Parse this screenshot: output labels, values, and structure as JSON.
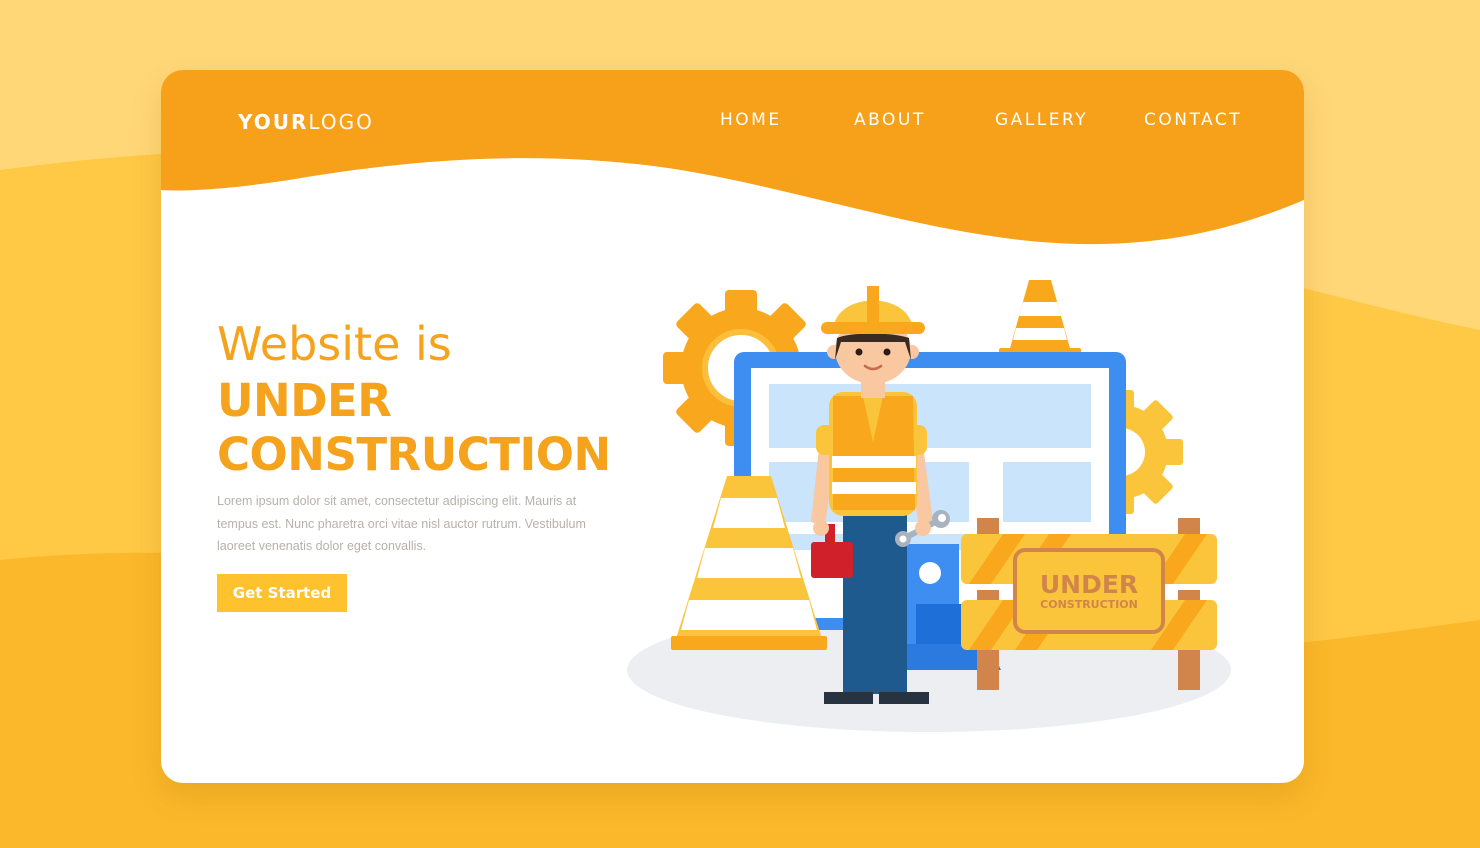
{
  "colors": {
    "bg_light": "#ffd777",
    "bg_mid": "#ffc845",
    "bg_dark": "#fbb82a",
    "header_orange": "#f7a01a",
    "accent": "#f5a21d",
    "button": "#fdc22d",
    "monitor_blue": "#3d8ef0",
    "screen_light": "#c9e4fb"
  },
  "logo": {
    "bold": "YOUR",
    "light": "LOGO"
  },
  "nav": {
    "items": [
      "HOME",
      "ABOUT",
      "GALLERY",
      "CONTACT"
    ]
  },
  "hero": {
    "title_light": "Website is",
    "title_bold_1": "UNDER",
    "title_bold_2": "CONSTRUCTION",
    "body": "Lorem ipsum dolor sit amet, consectetur adipiscing elit. Mauris at tempus est. Nunc pharetra orci vitae nisl auctor rutrum. Vestibulum laoreet venenatis dolor eget convallis.",
    "cta_label": "Get Started"
  },
  "sign": {
    "line1": "UNDER",
    "line2": "CONSTRUCTION"
  },
  "icons": [
    "gear-icon",
    "traffic-cone-icon",
    "monitor-icon",
    "worker-icon",
    "barrier-icon",
    "wrench-icon",
    "toolbox-icon"
  ]
}
